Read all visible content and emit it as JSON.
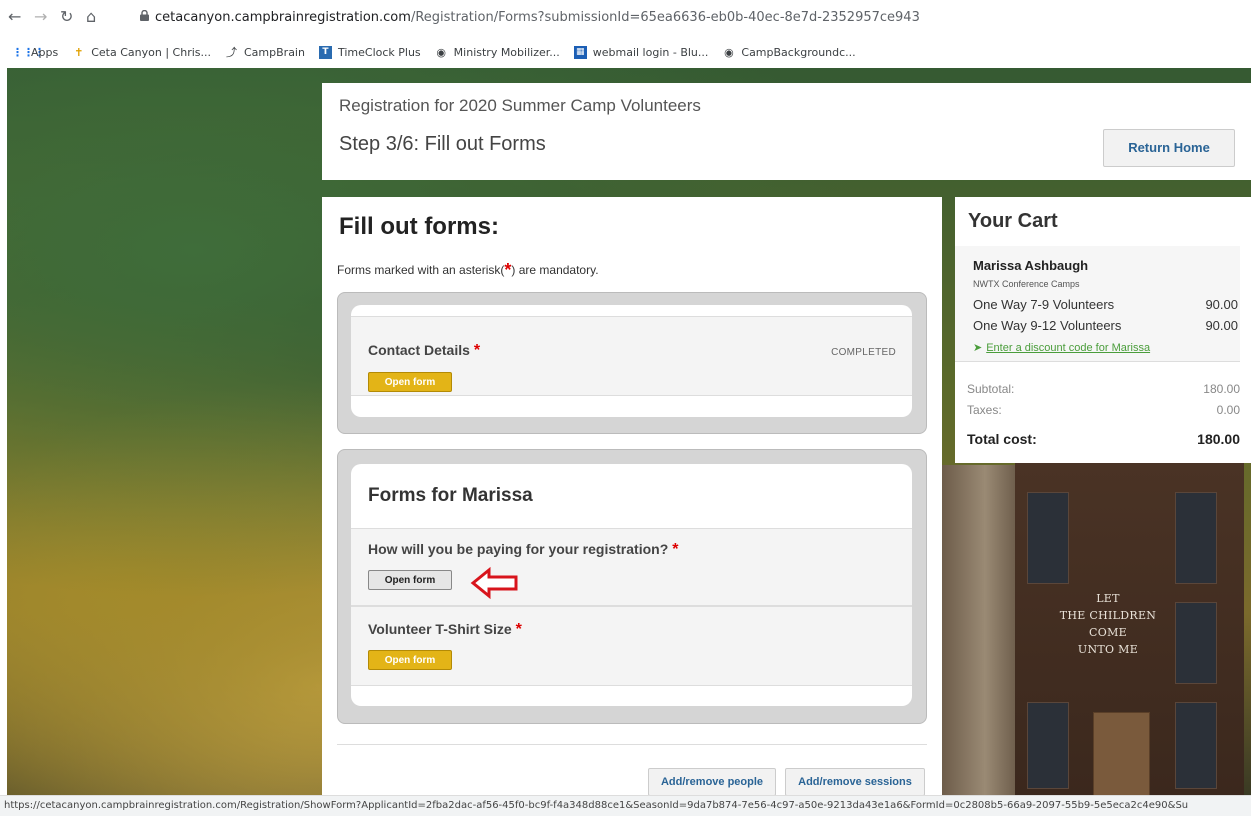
{
  "browser": {
    "url_host": "cetacanyon.campbrainregistration.com",
    "url_path": "/Registration/Forms?submissionId=65ea6636-eb0b-40ec-8e7d-2352957ce943",
    "bookmarks": [
      {
        "label": "Apps",
        "icon": "apps-grid-icon"
      },
      {
        "label": "Ceta Canyon | Chris...",
        "icon": "cross-icon"
      },
      {
        "label": "CampBrain",
        "icon": "campbrain-icon"
      },
      {
        "label": "TimeClock Plus",
        "icon": "timeclock-icon"
      },
      {
        "label": "Ministry Mobilizer...",
        "icon": "globe-icon"
      },
      {
        "label": "webmail login - Blu...",
        "icon": "grid-icon"
      },
      {
        "label": "CampBackgroundc...",
        "icon": "globe-icon"
      }
    ],
    "status_url": "https://cetacanyon.campbrainregistration.com/Registration/ShowForm?ApplicantId=2fba2dac-af56-45f0-bc9f-f4a348d88ce1&SeasonId=9da7b874-7e56-4c97-a50e-9213da43e1a6&FormId=0c2808b5-66a9-2097-55b9-5e5eca2c4e90&Su"
  },
  "header": {
    "registration_title": "Registration for 2020 Summer Camp Volunteers",
    "step_title": "Step 3/6: Fill out Forms",
    "return_home": "Return Home"
  },
  "main": {
    "title": "Fill out forms:",
    "mandatory_prefix": "Forms marked with an asterisk(",
    "mandatory_star": "*",
    "mandatory_suffix": ") are mandatory.",
    "contact": {
      "title": "Contact Details",
      "required": "*",
      "status": "COMPLETED",
      "button": "Open form"
    },
    "forms_group_title": "Forms for Marissa",
    "forms": [
      {
        "title": "How will you be paying for your registration?",
        "required": "*",
        "button": "Open form"
      },
      {
        "title": "Volunteer T-Shirt Size",
        "required": "*",
        "button": "Open form"
      }
    ],
    "add_remove_people": "Add/remove people",
    "add_remove_sessions": "Add/remove sessions"
  },
  "cart": {
    "title": "Your Cart",
    "name": "Marissa Ashbaugh",
    "org": "NWTX Conference Camps",
    "items": [
      {
        "label": "One Way 7-9 Volunteers",
        "amount": "90.00"
      },
      {
        "label": "One Way 9-12 Volunteers",
        "amount": "90.00"
      }
    ],
    "discount_link": "Enter a discount code for Marissa",
    "subtotal_label": "Subtotal:",
    "subtotal": "180.00",
    "taxes_label": "Taxes:",
    "taxes": "0.00",
    "total_label": "Total cost:",
    "total": "180.00"
  },
  "chapel_sign": [
    "LET",
    "THE CHILDREN",
    "COME",
    "UNTO ME"
  ]
}
